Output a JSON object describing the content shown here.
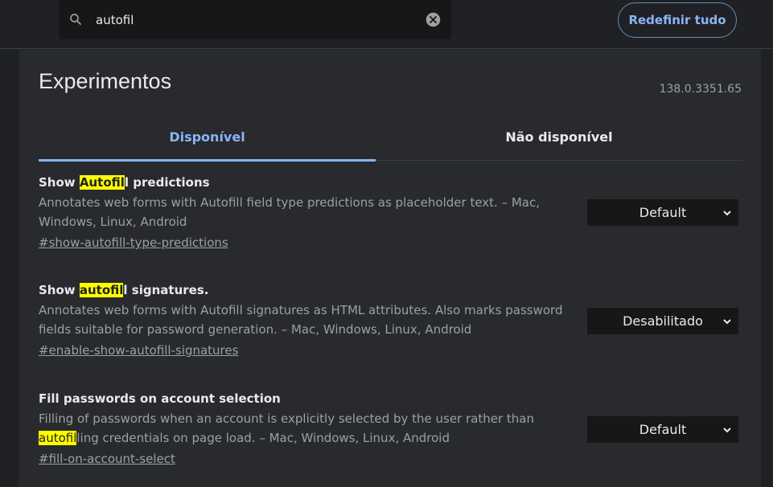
{
  "search": {
    "value": "autofil",
    "placeholder": "Pesquisar sinalizações"
  },
  "header": {
    "reset_label": "Redefinir tudo"
  },
  "page": {
    "title": "Experimentos",
    "version": "138.0.3351.65"
  },
  "tabs": [
    {
      "label": "Disponível",
      "active": true
    },
    {
      "label": "Não disponível",
      "active": false
    }
  ],
  "experiments": [
    {
      "title_pre": "Show ",
      "title_hl": "Autofil",
      "title_post": "l predictions",
      "desc_pre": "Annotates web forms with Autofill field type predictions as placeholder text. – Mac, Windows, Linux, Android",
      "desc_hl": "",
      "desc_post": "",
      "link": "#show-autofill-type-predictions",
      "value": "Default"
    },
    {
      "title_pre": "Show ",
      "title_hl": "autofil",
      "title_post": "l signatures.",
      "desc_pre": "Annotates web forms with Autofill signatures as HTML attributes. Also marks password fields suitable for password generation. – Mac, Windows, Linux, Android",
      "desc_hl": "",
      "desc_post": "",
      "link": "#enable-show-autofill-signatures",
      "value": "Desabilitado"
    },
    {
      "title_pre": "Fill passwords on account selection",
      "title_hl": "",
      "title_post": "",
      "desc_pre": "Filling of passwords when an account is explicitly selected by the user rather than ",
      "desc_hl": "autofil",
      "desc_post": "ling credentials on page load. – Mac, Windows, Linux, Android",
      "link": "#fill-on-account-select",
      "value": "Default"
    }
  ],
  "colors": {
    "background": "#202124",
    "card": "#292a2d",
    "accent": "#8ab4f8",
    "highlight": "#ffff00"
  },
  "icons": [
    "search-icon",
    "clear-icon",
    "chevron-down-icon"
  ]
}
